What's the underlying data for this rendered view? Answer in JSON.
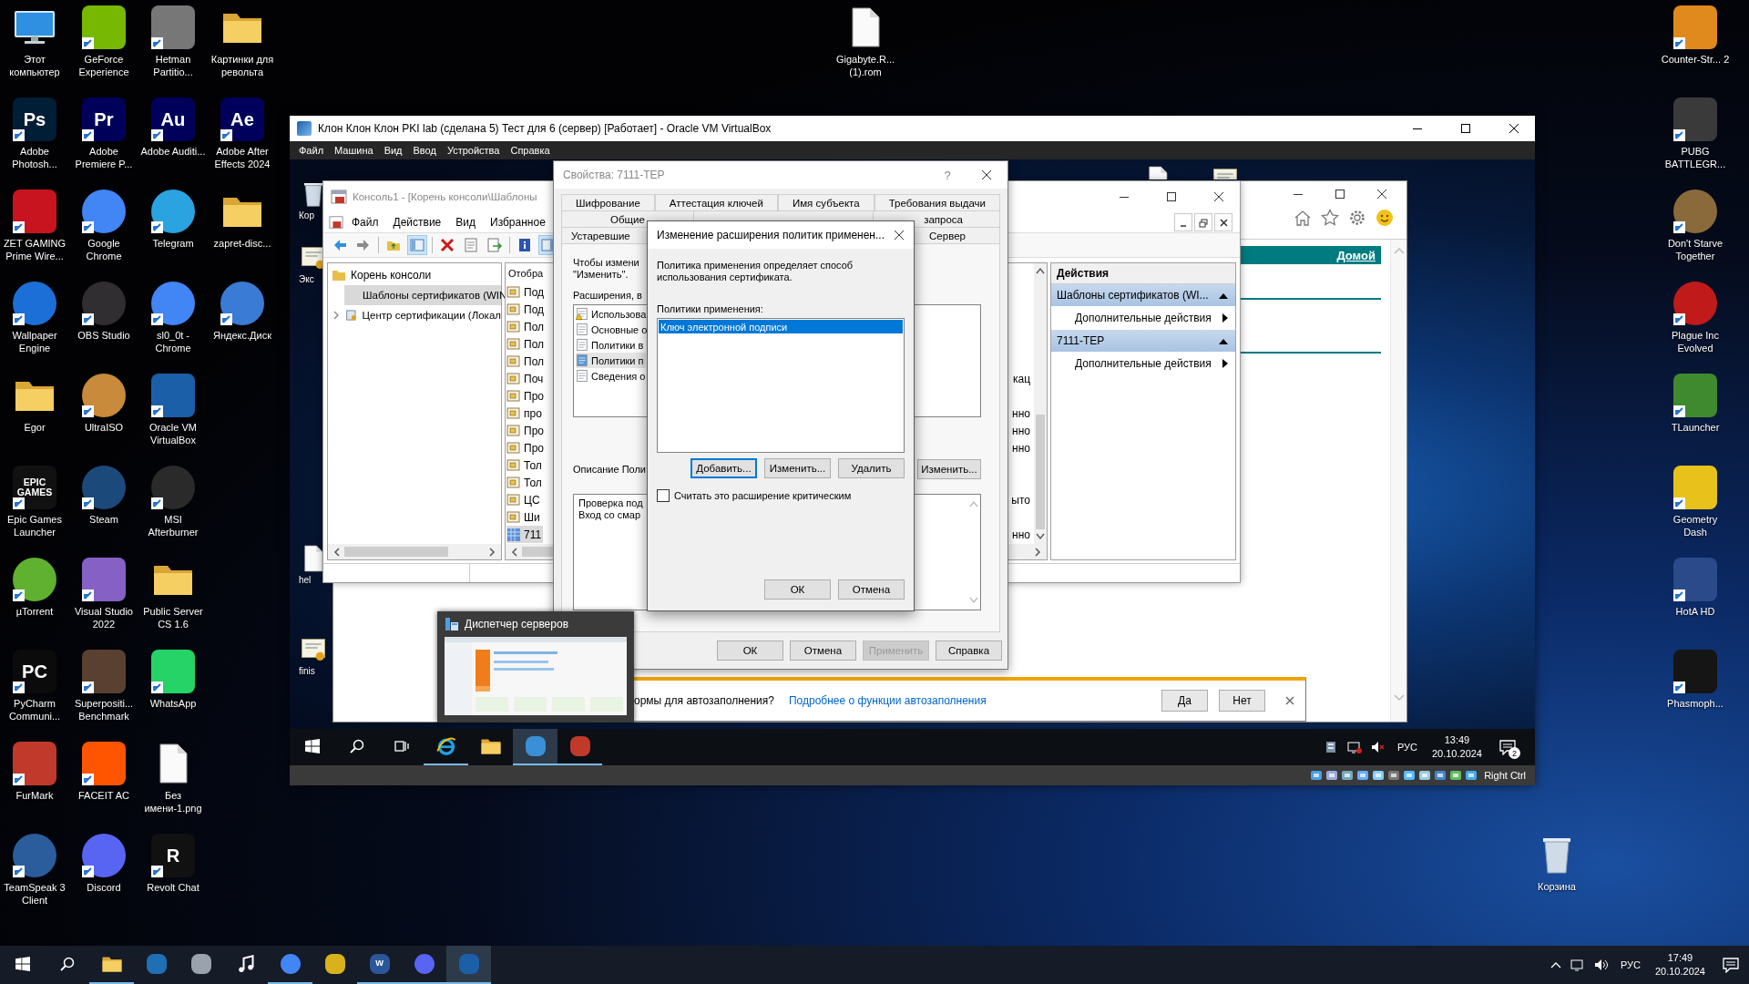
{
  "desktop_icons": [
    {
      "label": "Этот компьютер",
      "kind": "monitor"
    },
    {
      "label": "Adobe Photosh...",
      "kind": "app",
      "color": "#001e36",
      "glyph": "Ps"
    },
    {
      "label": "ZET GAMING Prime Wire...",
      "kind": "app",
      "color": "#c8141e"
    },
    {
      "label": "Wallpaper Engine",
      "kind": "round",
      "color": "#1c6fd6"
    },
    {
      "label": "Egor",
      "kind": "folder"
    },
    {
      "label": "Epic Games Launcher",
      "kind": "app",
      "color": "#111111",
      "glyph": "EPIC GAMES"
    },
    {
      "label": "µTorrent",
      "kind": "round",
      "color": "#5fb12f"
    },
    {
      "label": "PyCharm Communi...",
      "kind": "app",
      "color": "#0b0b0b",
      "glyph": "PC"
    },
    {
      "label": "FurMark",
      "kind": "app",
      "color": "#c0392b"
    },
    {
      "label": "TeamSpeak 3 Client",
      "kind": "round",
      "color": "#2b5d9c"
    },
    {
      "label": "GeForce Experience",
      "kind": "app",
      "color": "#76b900"
    },
    {
      "label": "Adobe Premiere P...",
      "kind": "app",
      "color": "#00005b",
      "glyph": "Pr"
    },
    {
      "label": "Google Chrome",
      "kind": "round",
      "color": "#4285f4"
    },
    {
      "label": "OBS Studio",
      "kind": "round",
      "color": "#302e31"
    },
    {
      "label": "UltraISO",
      "kind": "round",
      "color": "#c98a3c"
    },
    {
      "label": "Steam",
      "kind": "round",
      "color": "#1b4a7a"
    },
    {
      "label": "Visual Studio 2022",
      "kind": "app",
      "color": "#8661c5"
    },
    {
      "label": "Superpositi... Benchmark",
      "kind": "app",
      "color": "#5a4030"
    },
    {
      "label": "FACEIT AC",
      "kind": "app",
      "color": "#ff5500"
    },
    {
      "label": "Discord",
      "kind": "round",
      "color": "#5865f2"
    },
    {
      "label": "Hetman Partitio...",
      "kind": "app",
      "color": "#777777"
    },
    {
      "label": "Adobe Auditi...",
      "kind": "app",
      "color": "#00005b",
      "glyph": "Au"
    },
    {
      "label": "Telegram",
      "kind": "round",
      "color": "#2aa3e0"
    },
    {
      "label": "sl0_0t - Chrome",
      "kind": "round",
      "color": "#4285f5"
    },
    {
      "label": "Oracle VM VirtualBox",
      "kind": "app",
      "color": "#1b5fa8"
    },
    {
      "label": "MSI Afterburner",
      "kind": "round",
      "color": "#2a2a2a"
    },
    {
      "label": "Public Server CS 1.6",
      "kind": "folder"
    },
    {
      "label": "WhatsApp",
      "kind": "app",
      "color": "#25d366"
    },
    {
      "label": "Без имени-1.png",
      "kind": "file"
    },
    {
      "label": "Revolt Chat",
      "kind": "app",
      "color": "#111112",
      "glyph": "R"
    },
    {
      "label": "Картинки для револьта",
      "kind": "folder"
    },
    {
      "label": "Adobe After Effects 2024",
      "kind": "app",
      "color": "#00005c",
      "glyph": "Ae"
    },
    {
      "label": "zapret-disc...",
      "kind": "folder"
    },
    {
      "label": "Яндекс.Диск",
      "kind": "round",
      "color": "#3a7bd5"
    }
  ],
  "desktop_icons_right": [
    {
      "label": "Counter-Str... 2",
      "kind": "app",
      "color": "#e08a1e"
    },
    {
      "label": "PUBG BATTLEGR...",
      "kind": "app",
      "color": "#3a3a3a"
    },
    {
      "label": "Don't Starve Together",
      "kind": "round",
      "color": "#8a6a3a"
    },
    {
      "label": "Plague Inc Evolved",
      "kind": "round",
      "color": "#c01a1a"
    },
    {
      "label": "TLauncher",
      "kind": "app",
      "color": "#3f8a2e"
    },
    {
      "label": "Geometry Dash",
      "kind": "app",
      "color": "#e8c21a"
    },
    {
      "label": "HotA HD",
      "kind": "app",
      "color": "#2a4a8a"
    },
    {
      "label": "Phasmoph...",
      "kind": "app",
      "color": "#151515"
    }
  ],
  "desktop_loose_icons": [
    {
      "label": "Gigabyte.R... (1).rom",
      "kind": "file"
    },
    {
      "label": "Корзина",
      "kind": "bin"
    }
  ],
  "vm_window": {
    "title": "Клон Клон Клон PKI lab (сделана 5) Тест для 6 (сервер) [Работает] - Oracle VM VirtualBox",
    "menu": [
      "Файл",
      "Машина",
      "Вид",
      "Ввод",
      "Устройства",
      "Справка"
    ],
    "status_bar": {
      "host_key": "Right Ctrl"
    },
    "guest": {
      "desktop_icons": [
        {
          "label": "Кор",
          "kind": "bin"
        },
        {
          "label": "Экс",
          "kind": "cert"
        },
        {
          "label": "hel",
          "kind": "file"
        },
        {
          "label": "finis",
          "kind": "cert"
        },
        {
          "kind": "file"
        },
        {
          "kind": "cert"
        }
      ],
      "browser": {
        "home_link": "Домой",
        "infobar": {
          "question": "ормы для автозаполнения?",
          "link": "Подробнее о функции автозаполнения",
          "buttons": [
            "Да",
            "Нет"
          ]
        }
      },
      "console": {
        "title": "Консоль1 - [Корень консоли\\Шаблоны",
        "menu": [
          "Файл",
          "Действие",
          "Вид",
          "Избранное"
        ],
        "tree": [
          {
            "label": "Корень консоли",
            "selected": false,
            "children": [
              {
                "label": "Шаблоны сертификатов (WIN",
                "selected": true,
                "expandable": false
              },
              {
                "label": "Центр сертификации (Локал",
                "selected": false,
                "expandable": true
              }
            ]
          }
        ],
        "list_header": "Отобра",
        "list_rows": [
          {
            "name": "Под",
            "kind": "template",
            "selected": false
          },
          {
            "name": "Под",
            "kind": "template",
            "selected": false
          },
          {
            "name": "Пол",
            "kind": "template",
            "selected": false
          },
          {
            "name": "Пол",
            "kind": "template",
            "selected": false
          },
          {
            "name": "Пол",
            "kind": "template",
            "selected": false
          },
          {
            "name": "Поч",
            "kind": "template",
            "selected": false,
            "column_2": "кац"
          },
          {
            "name": "Про",
            "kind": "template",
            "selected": false
          },
          {
            "name": "про",
            "kind": "template",
            "selected": false,
            "column_2": "нно"
          },
          {
            "name": "Про",
            "kind": "template",
            "selected": false,
            "column_2": "нно"
          },
          {
            "name": "Про",
            "kind": "template",
            "selected": false,
            "column_2": "нно"
          },
          {
            "name": "Тол",
            "kind": "template",
            "selected": false
          },
          {
            "name": "Тол",
            "kind": "template",
            "selected": false
          },
          {
            "name": "ЦС",
            "kind": "template",
            "selected": false,
            "column_2": "ыто"
          },
          {
            "name": "Ши",
            "kind": "template",
            "selected": false
          },
          {
            "name": "711",
            "kind": "custom",
            "selected": true,
            "column_2": "нно"
          }
        ],
        "actions": {
          "title": "Действия",
          "groups": [
            {
              "title": "Шаблоны сертификатов (WI...",
              "expanded": true,
              "items": [
                "Дополнительные действия"
              ]
            },
            {
              "title": "7111-TEP",
              "expanded": true,
              "items": [
                "Дополнительные действия"
              ]
            }
          ]
        }
      },
      "properties": {
        "title": "Свойства: 7111-TEP",
        "help": "?",
        "tab_rows": [
          [
            {
              "label": "Шифрование",
              "selected": false
            },
            {
              "label": "Аттестация ключей",
              "selected": false
            },
            {
              "label": "Имя субъекта",
              "selected": false
            },
            {
              "label": "Требования выдачи",
              "selected": false
            }
          ],
          [
            {
              "label": "Общие",
              "selected": false
            },
            {
              "label": "запроса",
              "selected": false
            }
          ],
          [
            {
              "label": "Устаревшие",
              "selected": false
            },
            {
              "label": "Сервер",
              "selected": false
            }
          ]
        ],
        "intro": "Чтобы измени\n\"Изменить\".",
        "extensions_label": "Расширения, в",
        "extensions": [
          {
            "label": "Использова",
            "warning": true,
            "selected": false
          },
          {
            "label": "Основные о",
            "warning": false,
            "selected": false
          },
          {
            "label": "Политики в",
            "warning": false,
            "selected": false
          },
          {
            "label": "Политики п",
            "warning": false,
            "selected": true
          },
          {
            "label": "Сведения о",
            "warning": false,
            "selected": false
          }
        ],
        "description_label": "Описание Поли",
        "edit_button": "Изменить...",
        "description": [
          "Проверка под",
          "Вход со смар"
        ],
        "buttons": [
          {
            "label": "ОК",
            "disabled": false
          },
          {
            "label": "Отмена",
            "disabled": false
          },
          {
            "label": "Применить",
            "disabled": true
          },
          {
            "label": "Справка",
            "disabled": false
          }
        ]
      },
      "policy_dialog": {
        "title": "Изменение расширения политик применен...",
        "description": "Политика применения определяет способ использования сертификата.",
        "list_label": "Политики применения:",
        "policies": [
          {
            "label": "Ключ электронной подписи",
            "selected": true
          }
        ],
        "list_buttons": [
          {
            "label": "Добавить...",
            "focused": true
          },
          {
            "label": "Изменить...",
            "focused": false
          },
          {
            "label": "Удалить",
            "focused": false
          }
        ],
        "critical": {
          "label": "Считать это расширение критическим",
          "checked": false
        },
        "buttons": [
          {
            "label": "ОК"
          },
          {
            "label": "Отмена"
          }
        ]
      },
      "thumbnail": {
        "title": "Диспетчер серверов"
      },
      "taskbar": {
        "items": [
          {
            "kind": "start",
            "running": false,
            "active": false
          },
          {
            "kind": "search",
            "running": false,
            "active": false
          },
          {
            "kind": "taskview",
            "running": false,
            "active": false
          },
          {
            "kind": "browser",
            "running": true,
            "active": false
          },
          {
            "kind": "folder",
            "running": false,
            "active": false
          },
          {
            "kind": "app",
            "color": "#3a8fd6",
            "running": true,
            "active": true
          },
          {
            "kind": "app",
            "color": "#c0392b",
            "running": true,
            "active": false
          }
        ],
        "language": "РУС",
        "time": "13:49",
        "date": "20.10.2024",
        "notifications": "2"
      }
    }
  },
  "taskbar": {
    "items": [
      {
        "kind": "start",
        "running": false,
        "active": false
      },
      {
        "kind": "search",
        "running": false,
        "active": false
      },
      {
        "kind": "folder",
        "running": true,
        "active": false
      },
      {
        "kind": "app",
        "color": "#1f6fb5",
        "running": false,
        "active": false
      },
      {
        "kind": "app",
        "color": "#9aa3ad",
        "running": false,
        "active": false
      },
      {
        "kind": "note",
        "running": false,
        "active": false
      },
      {
        "kind": "round",
        "color": "#4285f4",
        "running": true,
        "active": false
      },
      {
        "kind": "app",
        "color": "#d8b21a",
        "running": false,
        "active": false
      },
      {
        "kind": "app",
        "color": "#2b579a",
        "glyph": "W",
        "running": true,
        "active": false
      },
      {
        "kind": "round",
        "color": "#5865f2",
        "running": true,
        "active": false
      },
      {
        "kind": "app",
        "color": "#1b5fa8",
        "running": true,
        "active": true
      }
    ],
    "language": "РУС",
    "time": "17:49",
    "date": "20.10.2024"
  }
}
